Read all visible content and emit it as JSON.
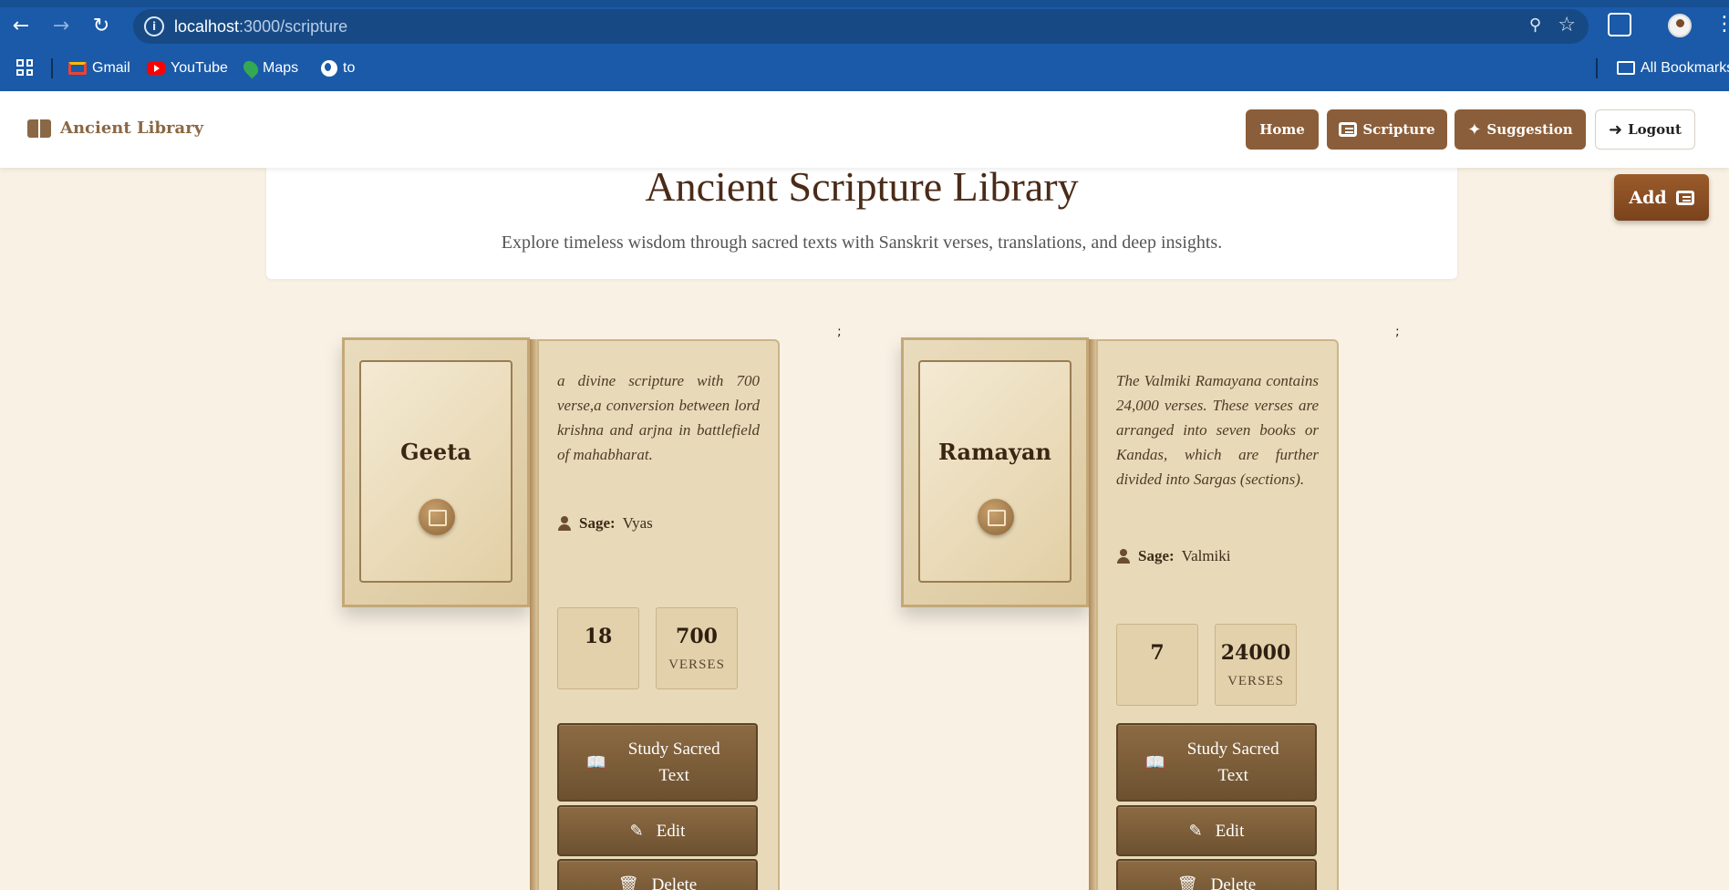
{
  "browser": {
    "url_host": "localhost",
    "url_path": ":3000/scripture",
    "bookmarks": [
      {
        "label": "Gmail",
        "icon": "gmail-icon"
      },
      {
        "label": "YouTube",
        "icon": "youtube-icon"
      },
      {
        "label": "Maps",
        "icon": "maps-icon"
      },
      {
        "label": "to",
        "icon": "globe-icon"
      }
    ],
    "all_bookmarks": "All Bookmarks"
  },
  "header": {
    "brand": "Ancient Library",
    "nav": {
      "home": "Home",
      "scripture": "Scripture",
      "suggestion": "Suggestion",
      "logout": "Logout"
    }
  },
  "hero": {
    "title": "Ancient Scripture Library",
    "subtitle": "Explore timeless wisdom through sacred texts with Sanskrit verses, translations, and deep insights."
  },
  "add_button": "Add",
  "cards": [
    {
      "title": "Geeta",
      "description": "a divine scripture with 700 verse,a conversion between lord krishna and arjna in battlefield of mahabharat.",
      "sage_label": "Sage:",
      "sage": "Vyas",
      "chapters": "18",
      "verses": "700",
      "verses_label": "VERSES",
      "study_label": "Study Sacred Text",
      "edit_label": "Edit",
      "delete_label": "Delete",
      "menu": ";"
    },
    {
      "title": "Ramayan",
      "description": "The Valmiki Ramayana contains 24,000 verses. These verses are arranged into seven books or Kandas, which are further divided into Sargas (sections).",
      "sage_label": "Sage:",
      "sage": "Valmiki",
      "chapters": "7",
      "verses": "24000",
      "verses_label": "VERSES",
      "study_label": "Study Sacred Text",
      "edit_label": "Edit",
      "delete_label": "Delete",
      "menu": ";"
    }
  ],
  "colors": {
    "brand_brown": "#8a5e3a",
    "page_bg": "#f9f1e4",
    "browser_blue": "#1a5aa8"
  }
}
